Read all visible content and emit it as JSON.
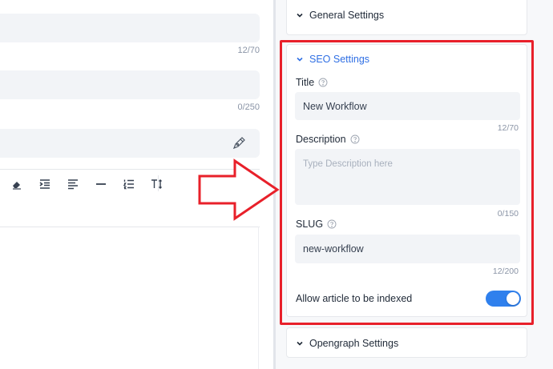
{
  "editor": {
    "field1_count": "12/70",
    "field2_count": "0/250"
  },
  "toolbar": {
    "tools": [
      "eraser-icon",
      "indent-icon",
      "align-left-icon",
      "horizontal-rule-icon",
      "ordered-list-icon",
      "text-size-icon"
    ]
  },
  "sidebar": {
    "general": {
      "label": "General Settings"
    },
    "seo": {
      "label": "SEO Settings",
      "title_label": "Title",
      "title_value": "New Workflow",
      "title_count": "12/70",
      "description_label": "Description",
      "description_placeholder": "Type Description here",
      "description_count": "0/150",
      "slug_label": "SLUG",
      "slug_value": "new-workflow",
      "slug_count": "12/200",
      "indexed_label": "Allow article to be indexed",
      "indexed_on": true
    },
    "opengraph": {
      "label": "Opengraph Settings"
    }
  },
  "colors": {
    "accent": "#2f6fe4",
    "toggle": "#2f80ed",
    "annotation": "#e8202a"
  }
}
